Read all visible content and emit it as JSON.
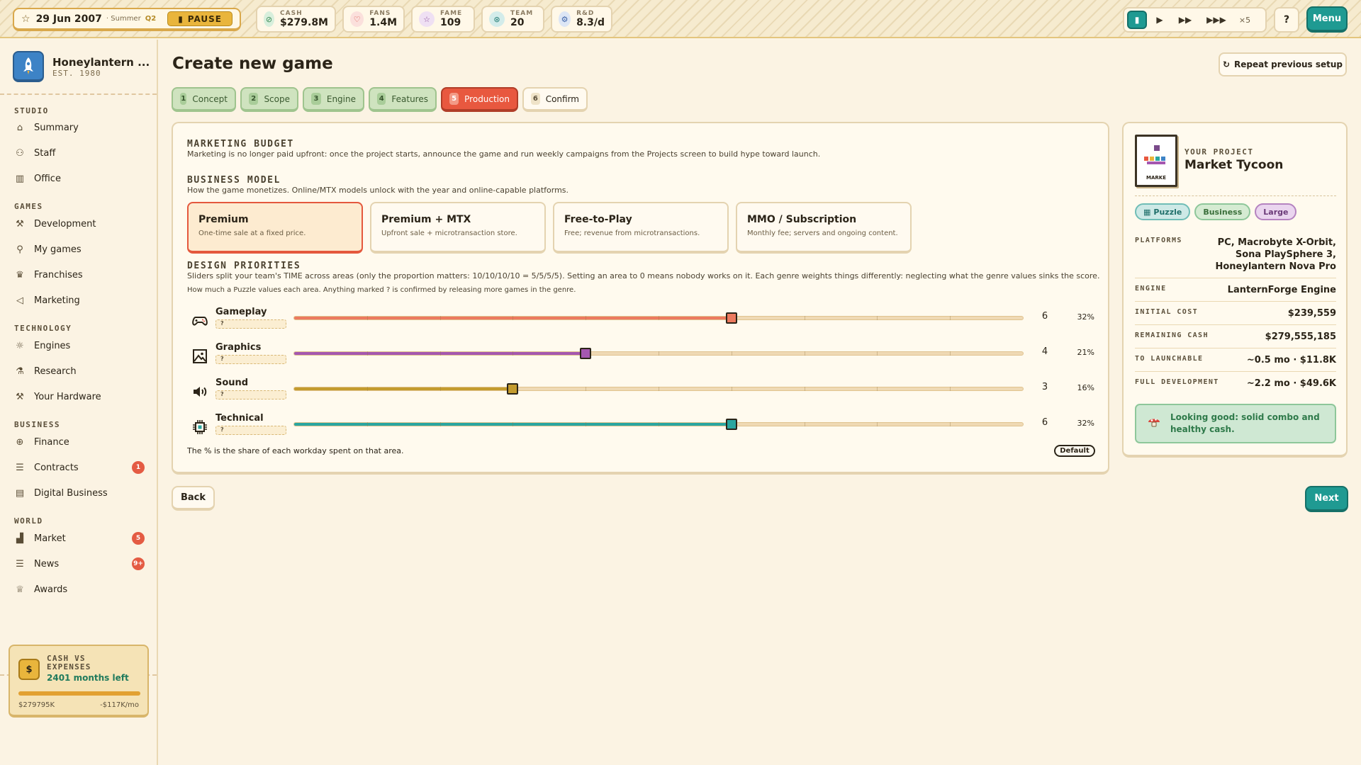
{
  "topbar": {
    "date": "29 Jun 2007",
    "season": "· Summer",
    "quarter": "Q2",
    "pause_label": "PAUSE",
    "stats": [
      {
        "label": "CASH",
        "value": "$279.8M",
        "icon": "cash-icon"
      },
      {
        "label": "FANS",
        "value": "1.4M",
        "icon": "heart-icon"
      },
      {
        "label": "FAME",
        "value": "109",
        "icon": "star-icon"
      },
      {
        "label": "TEAM",
        "value": "20",
        "icon": "team-icon"
      },
      {
        "label": "R&D",
        "value": "8.3/d",
        "icon": "gear-icon"
      }
    ],
    "speed_multiplier": "×5",
    "help_label": "?",
    "menu_label": "Menu"
  },
  "sidebar": {
    "studio_name": "Honeylantern ...",
    "studio_est": "EST. 1980",
    "sections": {
      "studio": "STUDIO",
      "games": "GAMES",
      "technology": "TECHNOLOGY",
      "business": "BUSINESS",
      "world": "WORLD"
    },
    "items": {
      "summary": "Summary",
      "staff": "Staff",
      "office": "Office",
      "development": "Development",
      "my_games": "My games",
      "franchises": "Franchises",
      "marketing": "Marketing",
      "engines": "Engines",
      "research": "Research",
      "your_hardware": "Your Hardware",
      "finance": "Finance",
      "contracts": "Contracts",
      "contracts_badge": "1",
      "digital_business": "Digital Business",
      "market": "Market",
      "market_badge": "5",
      "news": "News",
      "news_badge": "9+",
      "awards": "Awards"
    },
    "cash_card": {
      "title": "CASH VS EXPENSES",
      "months_left": "2401 months left",
      "cash": "$279795K",
      "burn": "-$117K/mo",
      "coin": "$",
      "progress": 1.0
    }
  },
  "main": {
    "title": "Create new game",
    "repeat_label": "Repeat previous setup",
    "steps": [
      {
        "n": "1",
        "label": "Concept"
      },
      {
        "n": "2",
        "label": "Scope"
      },
      {
        "n": "3",
        "label": "Engine"
      },
      {
        "n": "4",
        "label": "Features"
      },
      {
        "n": "5",
        "label": "Production"
      },
      {
        "n": "6",
        "label": "Confirm"
      }
    ],
    "marketing": {
      "heading": "MARKETING BUDGET",
      "desc": "Marketing is no longer paid upfront: once the project starts, announce the game and run weekly campaigns from the Projects screen to build hype toward launch."
    },
    "business_model": {
      "heading": "BUSINESS MODEL",
      "desc": "How the game monetizes. Online/MTX models unlock with the year and online-capable platforms.",
      "options": [
        {
          "title": "Premium",
          "desc": "One-time sale at a fixed price."
        },
        {
          "title": "Premium + MTX",
          "desc": "Upfront sale + microtransaction store."
        },
        {
          "title": "Free-to-Play",
          "desc": "Free; revenue from microtransactions."
        },
        {
          "title": "MMO / Subscription",
          "desc": "Monthly fee; servers and ongoing content."
        }
      ],
      "selected": "Premium"
    },
    "design": {
      "heading": "DESIGN PRIORITIES",
      "desc": "Sliders split your team's TIME across areas (only the proportion matters: 10/10/10/10 = 5/5/5/5). Setting an area to 0 means nobody works on it. Each genre weights things differently: neglecting what the genre values sinks the score.",
      "desc2": "How much a Puzzle values each area. Anything marked ? is confirmed by releasing more games in the genre.",
      "slider_max": 10,
      "sliders": [
        {
          "name": "Gameplay",
          "weight": "?",
          "value": 6,
          "pct": "32%",
          "color": "#ec7a5f",
          "icon": "gamepad-icon"
        },
        {
          "name": "Graphics",
          "weight": "?",
          "value": 4,
          "pct": "21%",
          "color": "#a557b0",
          "icon": "image-icon"
        },
        {
          "name": "Sound",
          "weight": "?",
          "value": 3,
          "pct": "16%",
          "color": "#c39b2e",
          "icon": "speaker-icon"
        },
        {
          "name": "Technical",
          "weight": "?",
          "value": 6,
          "pct": "32%",
          "color": "#2aa6a0",
          "icon": "chip-icon"
        }
      ],
      "footnote": "The % is the share of each workday spent on that area.",
      "default_label": "Default"
    },
    "back_label": "Back",
    "next_label": "Next"
  },
  "project": {
    "heading": "YOUR PROJECT",
    "name": "Market Tycoon",
    "cover_label": "MARKE",
    "tags": [
      {
        "label": "Puzzle",
        "bg": "#cde9e6",
        "border": "#6fbdb6",
        "color": "#1f6f6a"
      },
      {
        "label": "Business",
        "bg": "#d5ebd2",
        "border": "#8ec79a",
        "color": "#3a6f3a"
      },
      {
        "label": "Large",
        "bg": "#ead5ef",
        "border": "#b583c0",
        "color": "#6b3a78"
      }
    ],
    "rows": [
      {
        "key": "PLATFORMS",
        "value": "PC, Macrobyte X-Orbit, Sona PlaySphere 3, Honeylantern Nova Pro"
      },
      {
        "key": "ENGINE",
        "value": "LanternForge Engine"
      },
      {
        "key": "INITIAL COST",
        "value": "$239,559"
      },
      {
        "key": "REMAINING CASH",
        "value": "$279,555,185"
      },
      {
        "key": "TO LAUNCHABLE",
        "value": "~0.5 mo · $11.8K"
      },
      {
        "key": "FULL DEVELOPMENT",
        "value": "~2.2 mo · $49.6K"
      }
    ],
    "status": "Looking good: solid combo and healthy cash."
  }
}
